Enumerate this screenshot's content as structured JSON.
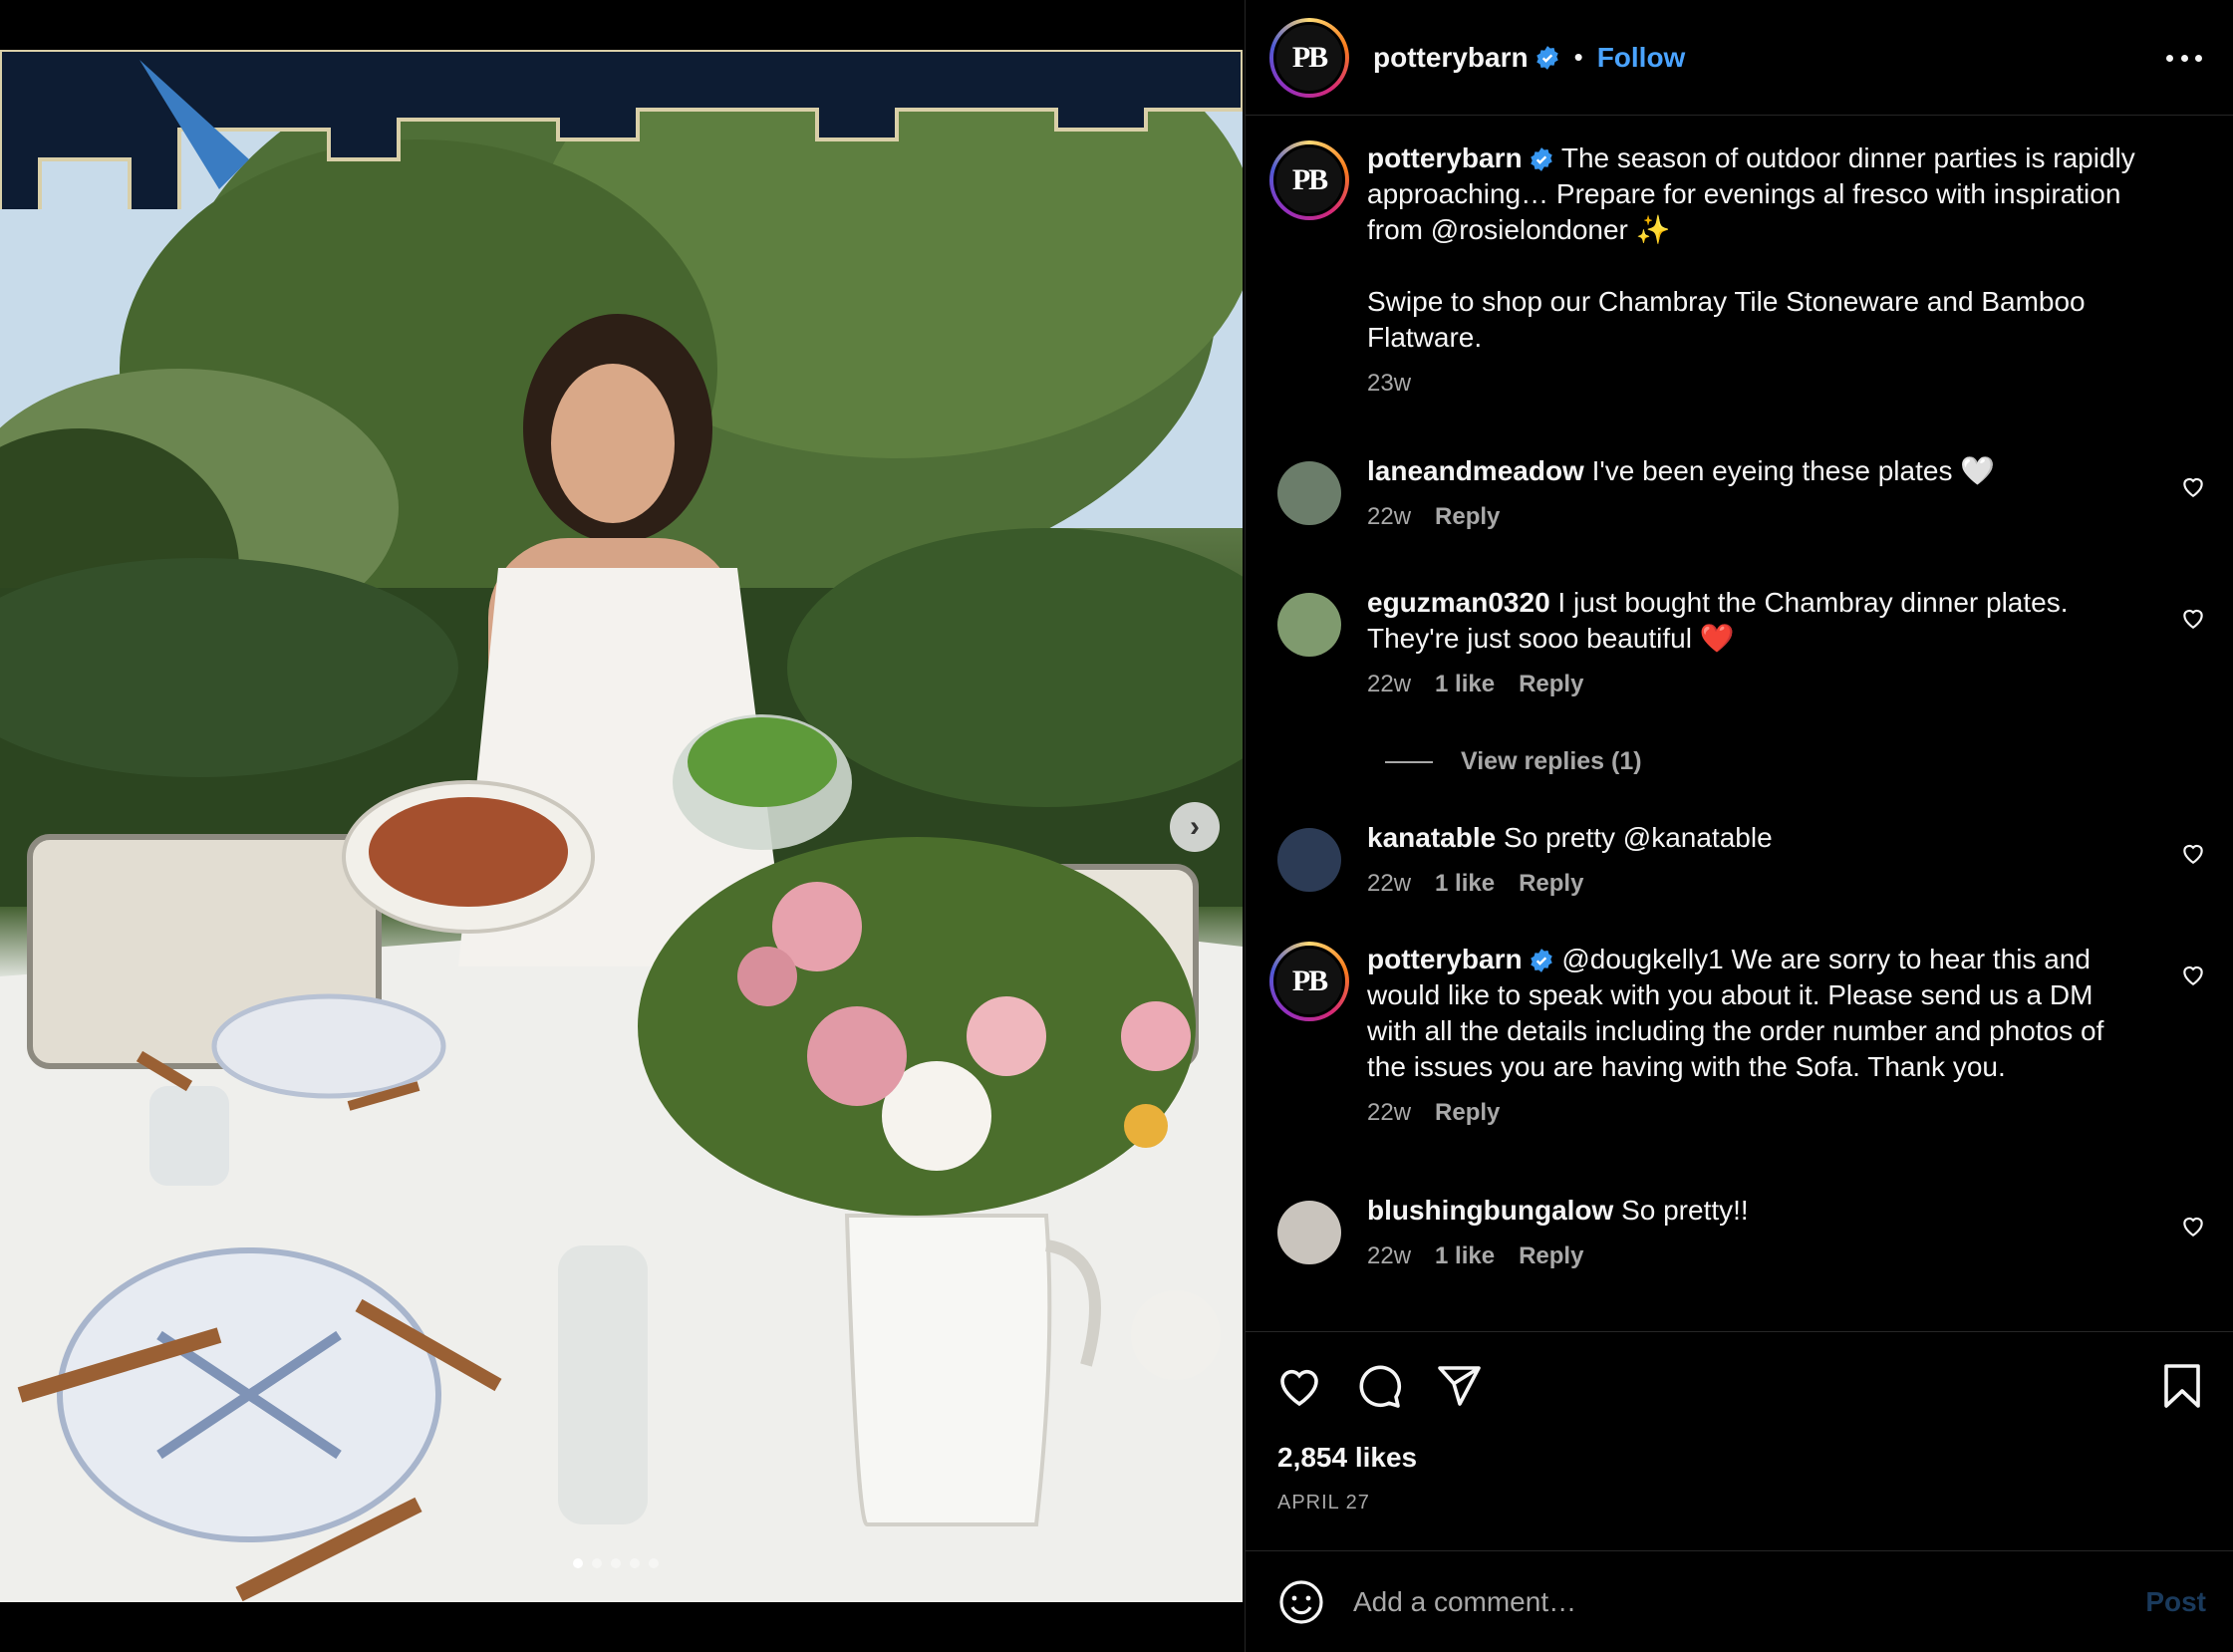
{
  "post": {
    "author": "potterybarn",
    "avatar_initials": "PB",
    "follow_label": "Follow",
    "separator": "•",
    "caption": {
      "username": "potterybarn",
      "text_1": "The season of outdoor dinner parties is rapidly approaching… Prepare for evenings al fresco with inspiration from @rosielondoner ✨",
      "text_2": "Swipe to shop our Chambray Tile Stoneware and Bamboo Flatware.",
      "time": "23w"
    },
    "likes": "2,854 likes",
    "date": "APRIL 27"
  },
  "comments": [
    {
      "username": "laneandmeadow",
      "text": "I've been eyeing these plates 🤍",
      "time": "22w",
      "likes": "",
      "reply_label": "Reply",
      "avatar_color": "#6b7d6a"
    },
    {
      "username": "eguzman0320",
      "text": "I just bought the Chambray dinner plates. They're just sooo beautiful ❤️",
      "time": "22w",
      "likes": "1 like",
      "reply_label": "Reply",
      "avatar_color": "#7f9a6e"
    },
    {
      "username": "kanatable",
      "text": "So pretty @kanatable",
      "time": "22w",
      "likes": "1 like",
      "reply_label": "Reply",
      "avatar_color": "#2c3b55"
    },
    {
      "username": "potterybarn",
      "text": "@dougkelly1 We are sorry to hear this and would like to speak with you about it. Please send us a DM with all the details including the order number and photos of the issues you are having with the Sofa. Thank you.",
      "time": "22w",
      "likes": "",
      "reply_label": "Reply",
      "avatar_color": "#111111"
    },
    {
      "username": "blushingbungalow",
      "text": "So pretty!!",
      "time": "22w",
      "likes": "1 like",
      "reply_label": "Reply",
      "avatar_color": "#c9c4bd"
    }
  ],
  "view_replies_label": "View replies (1)",
  "comment_input": {
    "placeholder": "Add a comment…",
    "post_label": "Post"
  },
  "carousel": {
    "slides": 5,
    "active": 1
  },
  "colors": {
    "accent": "#4aa3ff",
    "verified": "#3897f0",
    "muted": "#a8a8a8"
  }
}
